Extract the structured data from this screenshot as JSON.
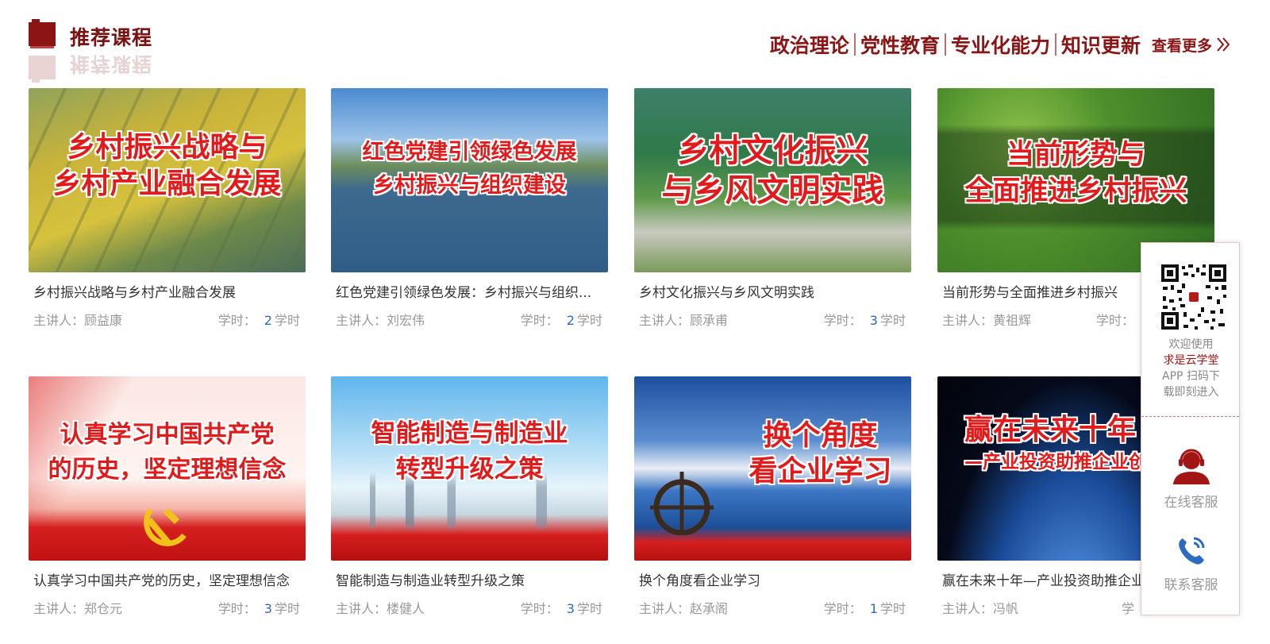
{
  "header": {
    "title": "推荐课程",
    "nav": [
      "政治理论",
      "党性教育",
      "专业化能力",
      "知识更新"
    ],
    "more": "查看更多"
  },
  "courses": [
    {
      "banner": [
        "乡村振兴战略与",
        "乡村产业融合发展"
      ],
      "title": "乡村振兴战略与乡村产业融合发展",
      "lecturer_label": "主讲人：",
      "lecturer": "顾益康",
      "hours_label": "学时：",
      "hours": "2",
      "hours_unit": "学时"
    },
    {
      "banner": [
        "红色党建引领绿色发展",
        "乡村振兴与组织建设"
      ],
      "title": "红色党建引领绿色发展：乡村振兴与组织...",
      "lecturer_label": "主讲人：",
      "lecturer": "刘宏伟",
      "hours_label": "学时：",
      "hours": "2",
      "hours_unit": "学时"
    },
    {
      "banner": [
        "乡村文化振兴",
        "与乡风文明实践"
      ],
      "title": "乡村文化振兴与乡风文明实践",
      "lecturer_label": "主讲人：",
      "lecturer": "顾承甫",
      "hours_label": "学时：",
      "hours": "3",
      "hours_unit": "学时"
    },
    {
      "banner": [
        "当前形势与",
        "全面推进乡村振兴"
      ],
      "title": "当前形势与全面推进乡村振兴",
      "lecturer_label": "主讲人：",
      "lecturer": "黄祖辉",
      "hours_label": "学时：",
      "hours": "",
      "hours_unit": ""
    },
    {
      "banner": [
        "认真学习中国共产党",
        "的历史，坚定理想信念"
      ],
      "title": "认真学习中国共产党的历史，坚定理想信念",
      "lecturer_label": "主讲人：",
      "lecturer": "郑仓元",
      "hours_label": "学时：",
      "hours": "3",
      "hours_unit": "学时"
    },
    {
      "banner": [
        "智能制造与制造业",
        "转型升级之策"
      ],
      "title": "智能制造与制造业转型升级之策",
      "lecturer_label": "主讲人：",
      "lecturer": "楼健人",
      "hours_label": "学时：",
      "hours": "3",
      "hours_unit": "学时"
    },
    {
      "banner": [
        "换个角度",
        "看企业学习"
      ],
      "title": "换个角度看企业学习",
      "lecturer_label": "主讲人：",
      "lecturer": "赵承阁",
      "hours_label": "学时：",
      "hours": "1",
      "hours_unit": "学时"
    },
    {
      "banner": [
        "赢在未来十年",
        "—产业投资助推企业创"
      ],
      "title": "赢在未来十年—产业投资助推企业",
      "lecturer_label": "主讲人：",
      "lecturer": "冯帆",
      "hours_label": "学",
      "hours": "",
      "hours_unit": ""
    }
  ],
  "float_panel": {
    "welcome_1": "欢迎使用",
    "brand": "求是云学堂",
    "welcome_2": "APP 扫码下",
    "welcome_3": "载即刻进入",
    "online_service": "在线客服",
    "contact_service": "联系客服"
  },
  "colors": {
    "brand": "#8b1414",
    "banner_text": "#e11b1b",
    "hours_num": "#2d6bbf",
    "meta": "#999999"
  }
}
